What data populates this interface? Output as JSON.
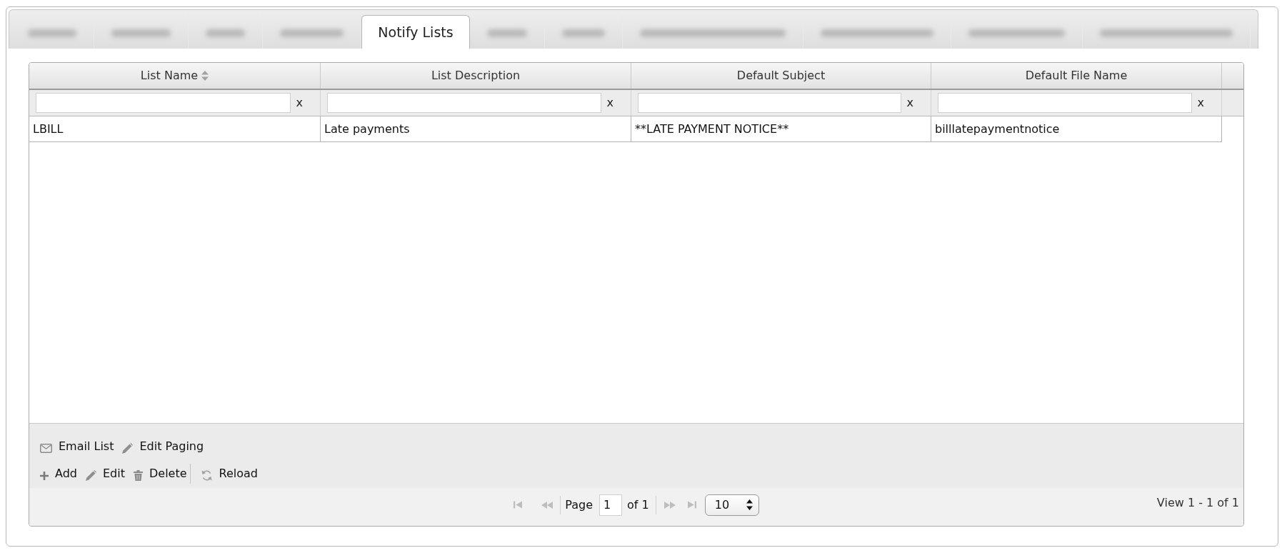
{
  "tabs": [
    {
      "kind": "blurred",
      "selected": false
    },
    {
      "kind": "blurred",
      "selected": false
    },
    {
      "kind": "blurred",
      "selected": false
    },
    {
      "kind": "blurred",
      "selected": false
    },
    {
      "kind": "label",
      "label": "Notify Lists",
      "selected": true
    },
    {
      "kind": "blurred",
      "selected": false
    },
    {
      "kind": "blurred",
      "selected": false
    },
    {
      "kind": "blurred",
      "selected": false
    },
    {
      "kind": "blurred",
      "selected": false
    },
    {
      "kind": "blurred",
      "selected": false
    },
    {
      "kind": "blurred",
      "selected": false
    }
  ],
  "grid": {
    "columns": [
      {
        "label": "List Name",
        "sorted": true
      },
      {
        "label": "List Description",
        "sorted": false
      },
      {
        "label": "Default Subject",
        "sorted": false
      },
      {
        "label": "Default File Name",
        "sorted": false
      }
    ],
    "filters": [
      {
        "clear": "x"
      },
      {
        "clear": "x"
      },
      {
        "clear": "x"
      },
      {
        "clear": "x"
      }
    ],
    "rows": [
      {
        "cells": [
          "LBILL",
          "Late payments",
          "**LATE PAYMENT NOTICE**",
          "billlatepaymentnotice"
        ]
      }
    ]
  },
  "toolbar": {
    "lines": [
      {
        "buttons": [
          {
            "kind": "email",
            "label": "Email List",
            "separator_before": false
          },
          {
            "kind": "edit",
            "label": "Edit Paging",
            "separator_before": false
          }
        ]
      },
      {
        "buttons": [
          {
            "kind": "add",
            "label": "Add",
            "separator_before": false
          },
          {
            "kind": "edit",
            "label": "Edit",
            "separator_before": false
          },
          {
            "kind": "delete",
            "label": "Delete",
            "separator_before": false
          },
          {
            "kind": "reload",
            "label": "Reload",
            "separator_before": true
          }
        ]
      }
    ]
  },
  "pager": {
    "nav_before": [
      {
        "kind": "first",
        "disabled": true
      },
      {
        "kind": "prev",
        "disabled": true
      }
    ],
    "page_label": "Page",
    "page": "1",
    "total_label": "of 1",
    "nav_after": [
      {
        "kind": "next",
        "disabled": true
      },
      {
        "kind": "last",
        "disabled": true
      }
    ],
    "page_size": "10",
    "view_info": "View 1 - 1 of 1"
  }
}
